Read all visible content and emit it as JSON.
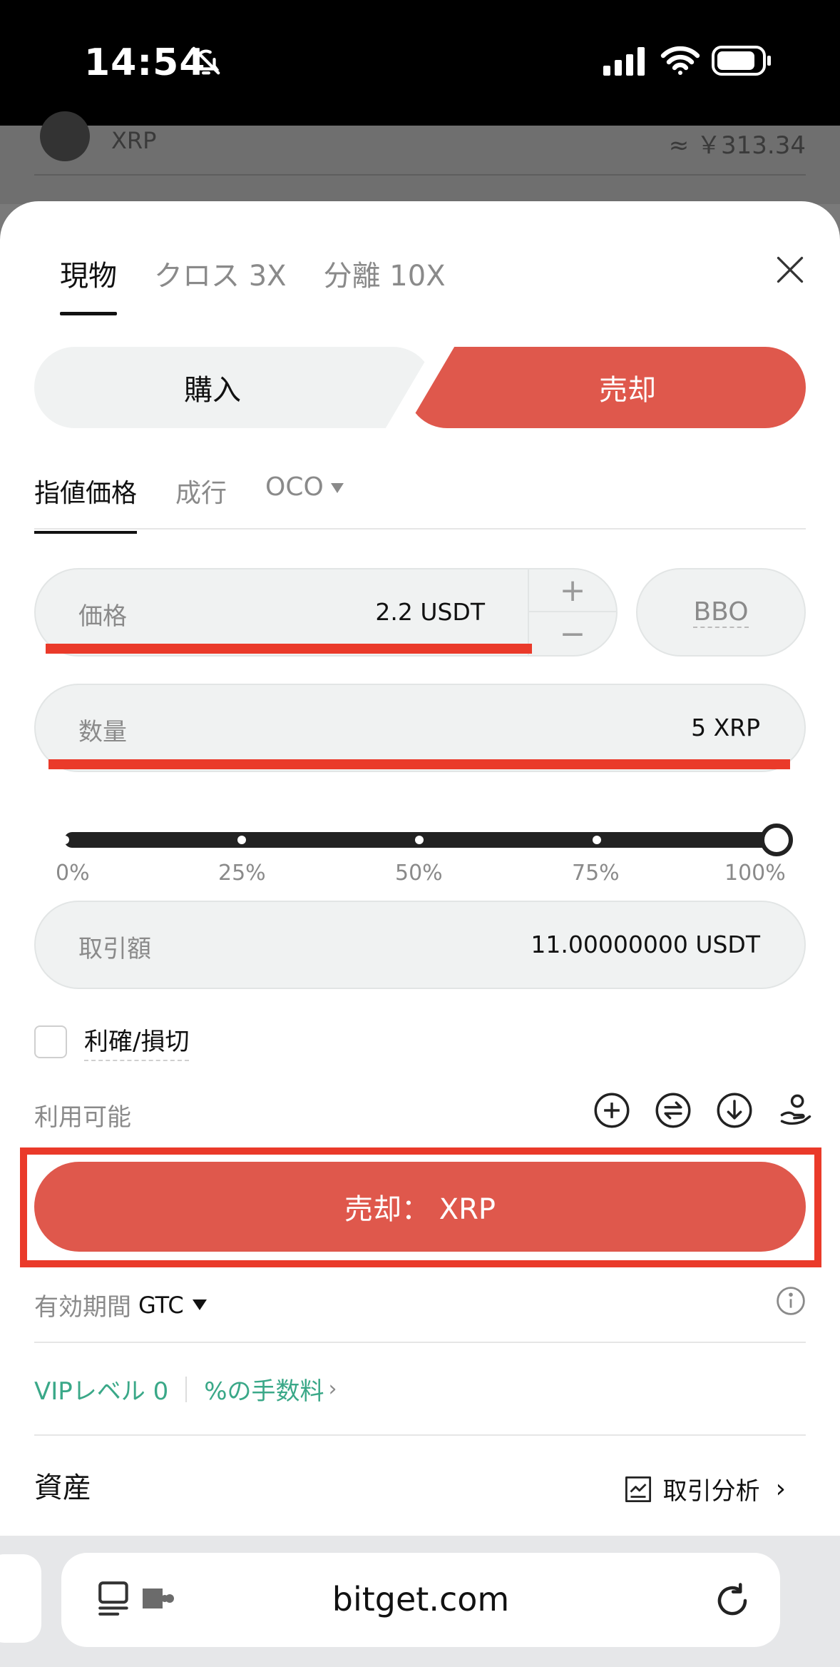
{
  "status_bar": {
    "time": "14:54"
  },
  "background_row": {
    "symbol": "XRP",
    "value": "≈ ￥313.34"
  },
  "tabs": [
    {
      "label": "現物",
      "active": true
    },
    {
      "label": "クロス 3X",
      "active": false
    },
    {
      "label": "分離 10X",
      "active": false
    }
  ],
  "side": {
    "buy_label": "購入",
    "sell_label": "売却",
    "selected": "sell"
  },
  "order_types": [
    {
      "label": "指値価格",
      "active": true
    },
    {
      "label": "成行",
      "active": false
    },
    {
      "label": "OCO",
      "active": false
    }
  ],
  "price": {
    "label": "価格",
    "value": "2.2 USDT",
    "plus": "+",
    "minus": "−"
  },
  "bbo_label": "BBO",
  "quantity": {
    "label": "数量",
    "value": "5 XRP"
  },
  "slider": {
    "ticks": [
      "0%",
      "25%",
      "50%",
      "75%",
      "100%"
    ],
    "value_percent": 100
  },
  "amount": {
    "label": "取引額",
    "value": "11.00000000 USDT"
  },
  "tpsl": {
    "label": "利確/損切",
    "checked": false
  },
  "available": {
    "label": "利用可能"
  },
  "submit": {
    "label": "売却： XRP"
  },
  "validity": {
    "label": "有効期間",
    "value": "GTC"
  },
  "fees": {
    "vip_label": "VIPレベル 0",
    "fee_label": "%の手数料",
    "chevron": "›"
  },
  "assets": {
    "title": "資産",
    "analysis_label": "取引分析",
    "chevron": "›"
  },
  "browser": {
    "url": "bitget.com"
  },
  "colors": {
    "sell": "#df584c",
    "highlight": "#ea3a2a",
    "accent_green": "#3aa888"
  },
  "icons": [
    "bell-slash-icon",
    "signal-icon",
    "wifi-icon",
    "battery-icon",
    "close-icon",
    "plus-circle-icon",
    "transfer-icon",
    "download-circle-icon",
    "coins-hand-icon",
    "info-icon",
    "chart-icon",
    "reader-icon",
    "extension-icon",
    "reload-icon"
  ]
}
